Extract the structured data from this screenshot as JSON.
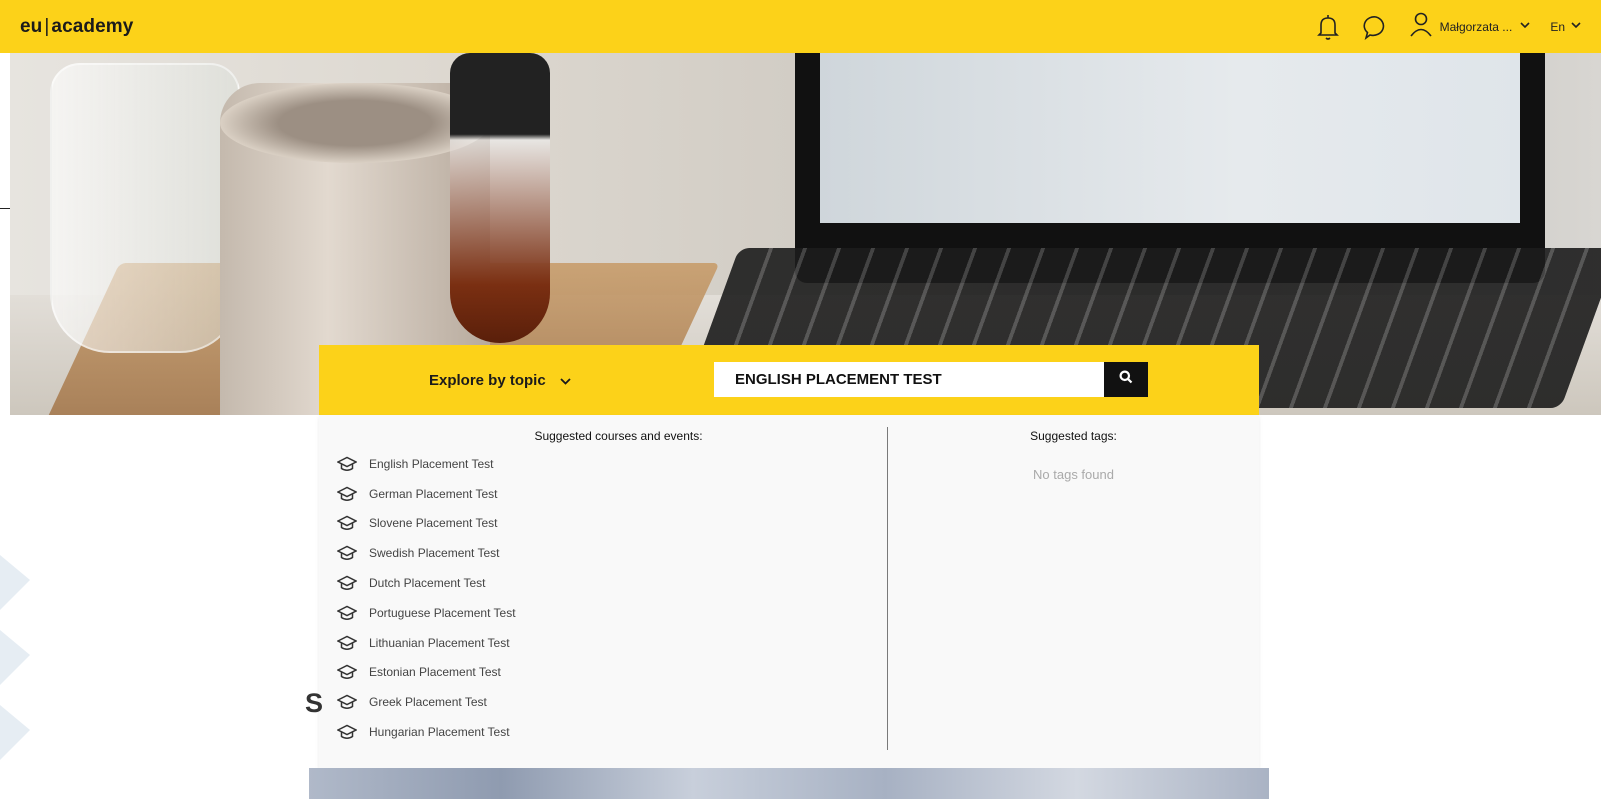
{
  "header": {
    "logo_left": "eu",
    "logo_sep": "|",
    "logo_right": "academy",
    "user_name": "Małgorzata ...",
    "language": "En",
    "icons": [
      "bell-icon",
      "chat-bubble-icon",
      "user-icon",
      "chevron-down-icon"
    ]
  },
  "search": {
    "explore_label": "Explore by topic",
    "query": "ENGLISH PLACEMENT TEST",
    "button_icon": "search-icon"
  },
  "dropdown": {
    "courses_title": "Suggested courses and events:",
    "tags_title": "Suggested tags:",
    "no_tags": "No tags found",
    "course_icon": "graduation-cap-icon",
    "courses": [
      "English Placement Test",
      "German Placement Test",
      "Slovene Placement Test",
      "Swedish Placement Test",
      "Dutch Placement Test",
      "Portuguese Placement Test",
      "Lithuanian Placement Test",
      "Estonian Placement Test",
      "Greek Placement Test",
      "Hungarian Placement Test"
    ]
  },
  "page": {
    "partial_heading": "S"
  },
  "colors": {
    "brand_yellow": "#fcd219",
    "dark": "#111111",
    "dropdown_bg": "#f9f9f9"
  }
}
